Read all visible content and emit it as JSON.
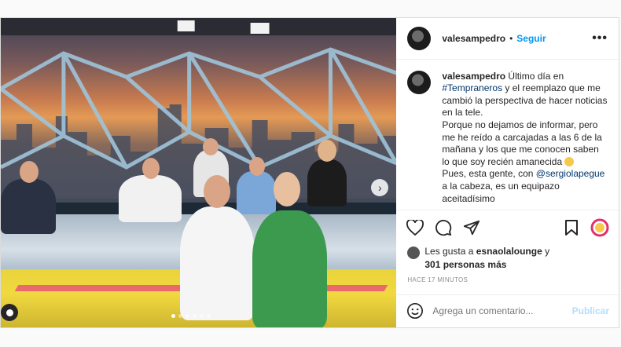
{
  "post": {
    "username": "valesampedro",
    "separator": "•",
    "follow_label": "Seguir",
    "more_label": "•••"
  },
  "caption": {
    "username": "valesampedro",
    "line1": " Último día en",
    "hashtag": "#Tempraneros",
    "line2": " y el reemplazo que me cambió la perspectiva de hacer noticias en la tele.",
    "line3": "Porque no dejamos de informar, pero me he reído a carcajadas a las 6 de la mañana y los que me conocen saben lo que soy recién amanecida",
    "line4a": "Pues, esta gente, con ",
    "mention": "@sergiolapegue",
    "line4b": " a la cabeza, es un equipazo aceitadísimo"
  },
  "likes": {
    "prefix": "Les gusta a ",
    "user": "esnaolalounge",
    "mid": " y",
    "others": "301 personas más"
  },
  "timestamp": "HACE 17 MINUTOS",
  "comment": {
    "placeholder": "Agrega un comentario...",
    "publish_label": "Publicar"
  },
  "carousel": {
    "slide_count": 6,
    "active_index": 0
  },
  "colors": {
    "accent": "#0095f6",
    "link": "#00376b",
    "muted": "#8e8e8e"
  }
}
